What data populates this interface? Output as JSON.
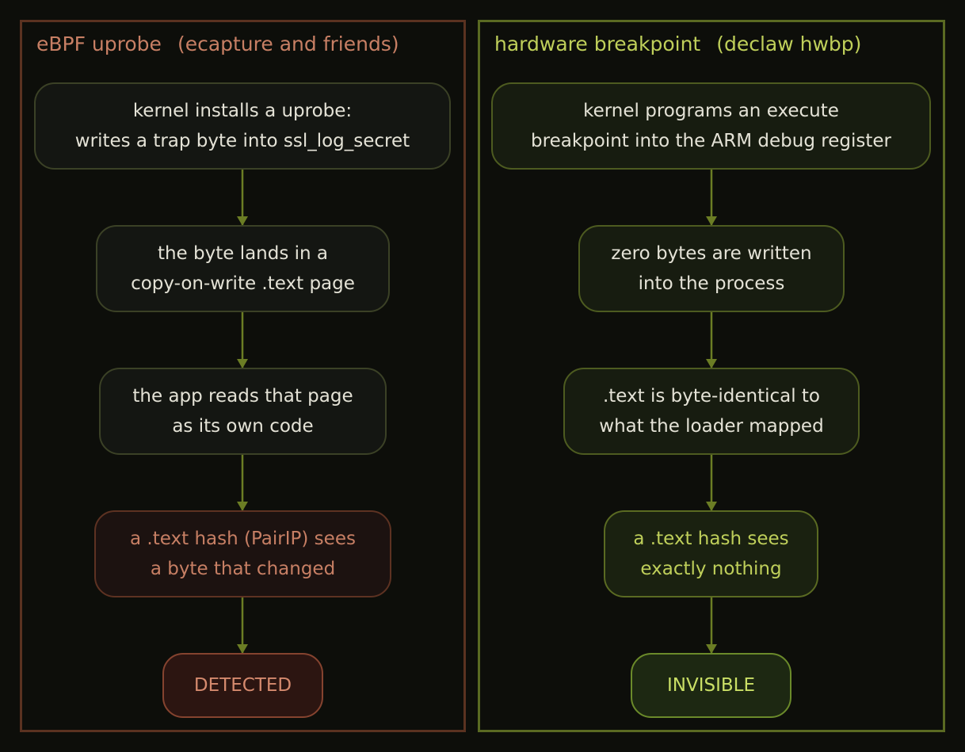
{
  "left": {
    "title": "eBPF uprobe",
    "subtitle": "(ecapture and friends)",
    "steps": [
      [
        "kernel installs a uprobe:",
        "writes a trap byte into ssl_log_secret"
      ],
      [
        "the byte lands in a",
        "copy-on-write .text page"
      ],
      [
        "the app reads that page",
        "as its own code"
      ],
      [
        "a .text hash (PairIP) sees",
        "a byte that changed"
      ]
    ],
    "result": "DETECTED"
  },
  "right": {
    "title": "hardware breakpoint",
    "subtitle": "(declaw hwbp)",
    "steps": [
      [
        "kernel programs an execute",
        "breakpoint into the ARM debug register"
      ],
      [
        "zero bytes are written",
        "into the process"
      ],
      [
        ".text is byte-identical to",
        "what the loader mapped"
      ],
      [
        "a .text hash sees",
        "exactly nothing"
      ]
    ],
    "result": "INVISIBLE"
  },
  "colors": {
    "background": "#0d0e0a",
    "left_accent": "#c77f64",
    "right_accent": "#bfcf5a",
    "arrow": "#6b7d24"
  }
}
